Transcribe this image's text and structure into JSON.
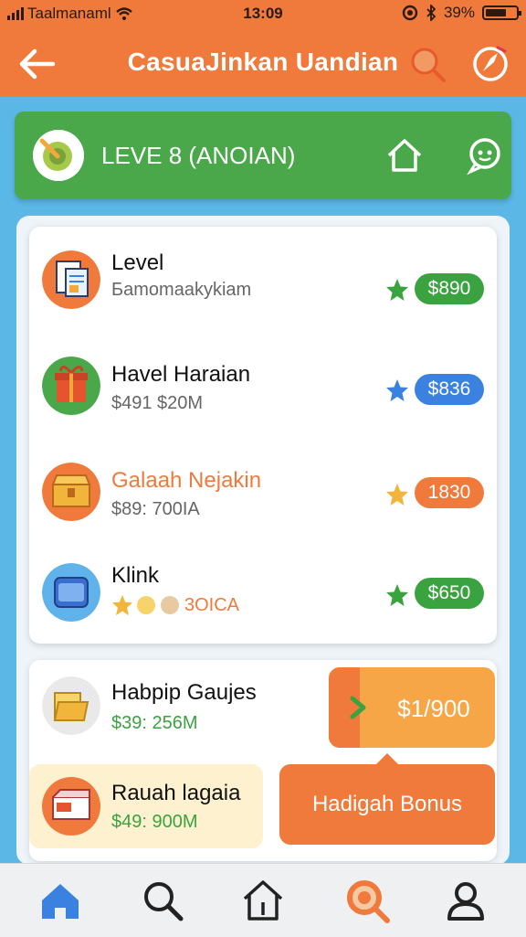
{
  "status": {
    "carrier": "Taalmanaml",
    "time": "13:09",
    "battery": "39%"
  },
  "header": {
    "title": "CasuaJinkan Uandian"
  },
  "level_banner": {
    "label": "LEVE 8 (ANOIAN)"
  },
  "items": [
    {
      "name": "Level",
      "sub": "Бamomaakykiam",
      "price": "$890",
      "accent": "#3aa340"
    },
    {
      "name": "Havel Haraian",
      "sub": "$491 $20M",
      "price": "$836",
      "accent": "#3b82e0"
    },
    {
      "name": "Galaah Nejakin",
      "sub": "$89: 700IA",
      "price": "1830",
      "accent": "#ef7a3b"
    },
    {
      "name": "Klink",
      "sub": "3OICA",
      "price": "$650",
      "accent": "#3aa340"
    }
  ],
  "rewards": [
    {
      "name": "Habpip Gaujes",
      "sub": "$39: 256M"
    },
    {
      "name": "Rauah lagaia",
      "sub": "$49: 900M"
    }
  ],
  "price_button": {
    "label": "$1/900"
  },
  "bonus_button": {
    "label": "Hadigah Bonus"
  },
  "tabs": [
    "home",
    "search",
    "house",
    "discover",
    "profile"
  ]
}
